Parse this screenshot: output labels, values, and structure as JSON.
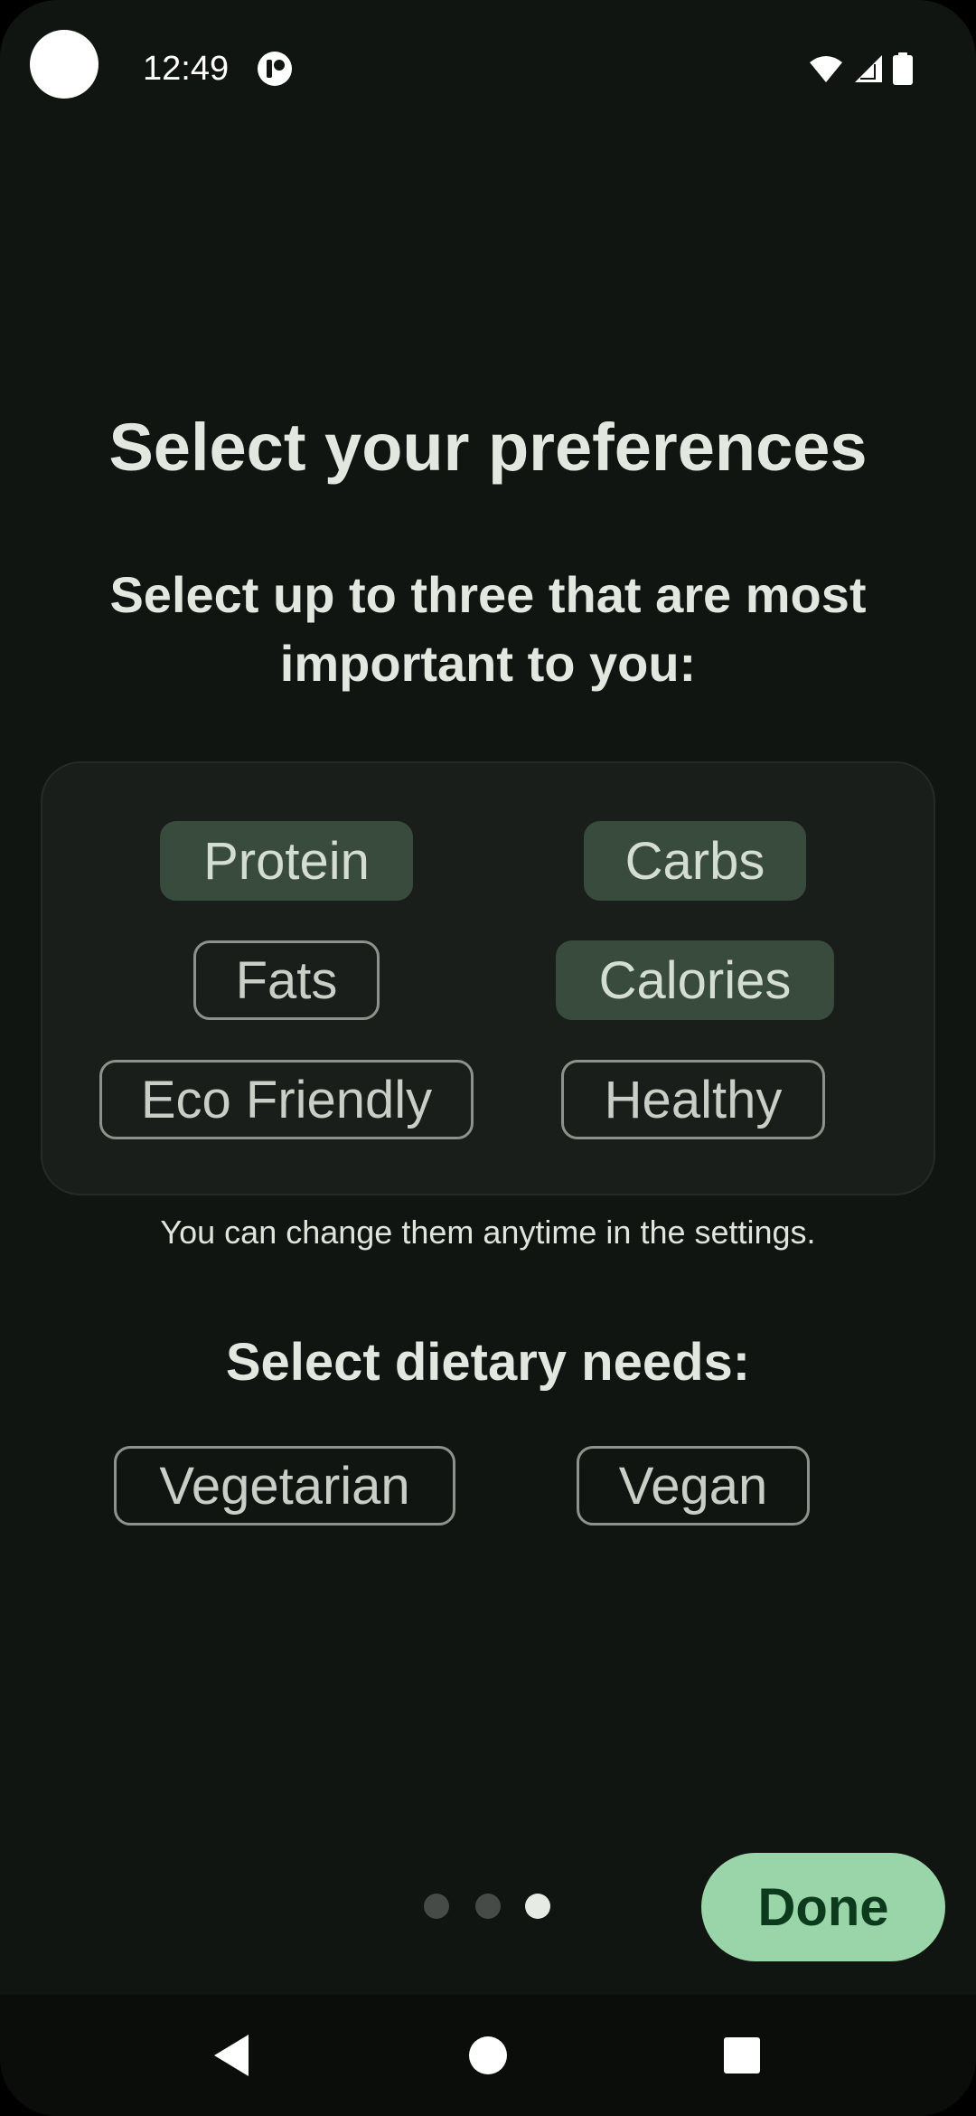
{
  "status_bar": {
    "time": "12:49",
    "icons": [
      "camera-cutout",
      "app-notification-icon",
      "wifi-icon",
      "cellular-signal-icon",
      "battery-icon"
    ]
  },
  "screen": {
    "title": "Select your preferences",
    "subtitle": "Select up to three that are most important to you:",
    "hint": "You can change them anytime in the settings.",
    "dietary_title": "Select dietary needs:"
  },
  "preferences": [
    {
      "label": "Protein",
      "selected": true
    },
    {
      "label": "Carbs",
      "selected": true
    },
    {
      "label": "Fats",
      "selected": false
    },
    {
      "label": "Calories",
      "selected": true
    },
    {
      "label": "Eco Friendly",
      "selected": false
    },
    {
      "label": "Healthy",
      "selected": false
    }
  ],
  "dietary_needs": [
    {
      "label": "Vegetarian",
      "selected": false
    },
    {
      "label": "Vegan",
      "selected": false
    }
  ],
  "pager": {
    "page_count": 3,
    "current_page": 3
  },
  "done_label": "Done",
  "navigation": {
    "icons": [
      "back-icon",
      "home-icon",
      "recents-icon"
    ]
  },
  "colors": {
    "background": "#111511",
    "card": "#1a1e1a",
    "chip_selected": "#394b3c",
    "chip_outline": "#8c938a",
    "accent_button": "#99d5a8",
    "accent_button_text": "#0b3a1c"
  }
}
